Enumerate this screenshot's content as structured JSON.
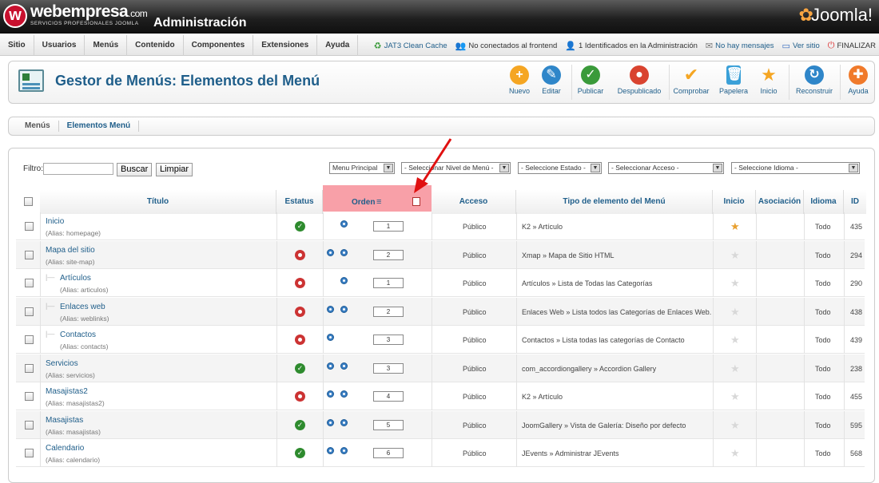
{
  "header": {
    "logo_letter": "w",
    "brand": "webempresa",
    "brand_domain": ".com",
    "brand_sub": "SERVICIOS PROFESIONALES JOOMLA",
    "admin_title": "Administración",
    "joomla": "Joomla!"
  },
  "menubar": {
    "items": [
      "Sitio",
      "Usuarios",
      "Menús",
      "Contenido",
      "Componentes",
      "Extensiones",
      "Ayuda"
    ]
  },
  "status": {
    "cache": "JAT3 Clean Cache",
    "frontend": "No conectados al frontend",
    "admin": "1 Identificados en la Administración",
    "messages": "No hay mensajes",
    "view_site": "Ver sitio",
    "logout": "FINALIZAR"
  },
  "toolbar": {
    "title": "Gestor de Menús: Elementos del Menú",
    "buttons": [
      "Nuevo",
      "Editar",
      "Publicar",
      "Despublicado",
      "Comprobar",
      "Papelera",
      "Inicio",
      "Reconstruir",
      "Ayuda"
    ]
  },
  "submenu": {
    "items": [
      "Menús",
      "Elementos Menú"
    ]
  },
  "filter": {
    "label": "Filtro:",
    "value": "",
    "search": "Buscar",
    "clear": "Limpiar",
    "selects": [
      "Menu Principal",
      "- Seleccionar Nivel de Menú -",
      "- Seleccione Estado -",
      "- Seleccionar Acceso -",
      "- Seleccione Idioma -"
    ]
  },
  "table": {
    "headers": {
      "title": "Título",
      "status": "Estatus",
      "order": "Orden",
      "access": "Acceso",
      "type": "Tipo de elemento del Menú",
      "home": "Inicio",
      "association": "Asociación",
      "language": "Idioma",
      "id": "ID"
    },
    "rows": [
      {
        "title": "Inicio",
        "alias_label": "(Alias:",
        "alias": "homepage)",
        "status": "published",
        "up": false,
        "down": true,
        "order": "1",
        "access": "Público",
        "type": "K2 » Artículo",
        "home": true,
        "language": "Todo",
        "id": "435",
        "indent": false
      },
      {
        "title": "Mapa del sitio",
        "alias_label": "(Alias:",
        "alias": "site-map)",
        "status": "unpublished",
        "up": true,
        "down": true,
        "order": "2",
        "access": "Público",
        "type": "Xmap » Mapa de Sitio HTML",
        "home": false,
        "language": "Todo",
        "id": "294",
        "indent": false
      },
      {
        "title": "Artículos",
        "alias_label": "(Alias:",
        "alias": "articulos)",
        "status": "unpublished",
        "up": false,
        "down": true,
        "order": "1",
        "access": "Público",
        "type": "Artículos » Lista de Todas las Categorías",
        "home": false,
        "language": "Todo",
        "id": "290",
        "indent": true
      },
      {
        "title": "Enlaces web",
        "alias_label": "(Alias:",
        "alias": "weblinks)",
        "status": "unpublished",
        "up": true,
        "down": true,
        "order": "2",
        "access": "Público",
        "type": "Enlaces Web » Lista todos las Categorías de Enlaces Web.",
        "home": false,
        "language": "Todo",
        "id": "438",
        "indent": true
      },
      {
        "title": "Contactos",
        "alias_label": "(Alias:",
        "alias": "contacts)",
        "status": "unpublished",
        "up": true,
        "down": false,
        "order": "3",
        "access": "Público",
        "type": "Contactos » Lista todas las categorías de Contacto",
        "home": false,
        "language": "Todo",
        "id": "439",
        "indent": true
      },
      {
        "title": "Servicios",
        "alias_label": "(Alias:",
        "alias": "servicios)",
        "status": "published",
        "up": true,
        "down": true,
        "order": "3",
        "access": "Público",
        "type": "com_accordiongallery » Accordion Gallery",
        "home": false,
        "language": "Todo",
        "id": "238",
        "indent": false
      },
      {
        "title": "Masajistas2",
        "alias_label": "(Alias:",
        "alias": "masajistas2)",
        "status": "unpublished",
        "up": true,
        "down": true,
        "order": "4",
        "access": "Público",
        "type": "K2 » Artículo",
        "home": false,
        "language": "Todo",
        "id": "455",
        "indent": false
      },
      {
        "title": "Masajistas",
        "alias_label": "(Alias:",
        "alias": "masajistas)",
        "status": "published",
        "up": true,
        "down": true,
        "order": "5",
        "access": "Público",
        "type": "JoomGallery » Vista de Galería: Diseño por defecto",
        "home": false,
        "language": "Todo",
        "id": "595",
        "indent": false
      },
      {
        "title": "Calendario",
        "alias_label": "(Alias:",
        "alias": "calendario)",
        "status": "published",
        "up": true,
        "down": true,
        "order": "6",
        "access": "Público",
        "type": "JEvents » Administrar JEvents",
        "home": false,
        "language": "Todo",
        "id": "568",
        "indent": false
      }
    ]
  },
  "colors": {
    "accent": "#1f5e8a",
    "highlight": "#f8a0a8",
    "arrow": "#e01010"
  }
}
